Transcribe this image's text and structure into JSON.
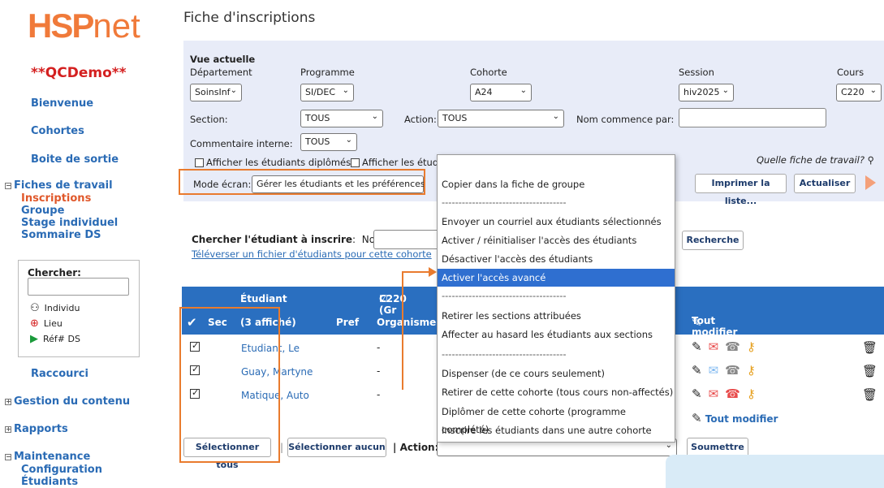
{
  "sidebar": {
    "logo_main": "HSP",
    "logo_suffix": "net",
    "demo": "**QCDemo**",
    "links": [
      "Bienvenue",
      "Cohortes",
      "Boite de sortie"
    ],
    "fiches_title": "Fiches de travail",
    "fiches_items": [
      "Inscriptions",
      "Groupe",
      "Stage individuel",
      "Sommaire DS"
    ],
    "search_label": "Chercher",
    "search_options": [
      "Individu",
      "Lieu",
      "Réf# DS"
    ],
    "raccourci": "Raccourci",
    "sections": [
      "Gestion du contenu",
      "Rapports",
      "Maintenance"
    ],
    "maint_items": [
      "Configuration",
      "Étudiants"
    ]
  },
  "page_title": "Fiche d'inscriptions",
  "filters": {
    "current_view": "Vue actuelle",
    "dept_label": "Département",
    "dept_value": "SoinsInf",
    "prog_label": "Programme",
    "prog_value": "SI/DEC",
    "cohort_label": "Cohorte",
    "cohort_value": "A24",
    "session_label": "Session",
    "session_value": "hiv2025",
    "course_label": "Cours",
    "course_value": "C220",
    "section_label": "Section:",
    "section_value": "TOUS",
    "action_label": "Action:",
    "action_value": "TOUS",
    "name_starts_label": "Nom commence par:",
    "comment_label": "Commentaire interne:",
    "comment_value": "TOUS",
    "cb1": "Afficher les étudiants diplômés",
    "cb2": "Afficher les étud",
    "which_sheet": "Quelle fiche de travail?",
    "mode_label": "Mode écran:",
    "mode_value": "Gérer les étudiants et les préférences",
    "print_btn": "Imprimer la liste...",
    "refresh_btn": "Actualiser"
  },
  "search_student": {
    "label": "Chercher l'étudiant à inscrire",
    "name_label": "Nom:",
    "upload_link": "Téléverser un fichier d'étudiants pour cette cohorte",
    "search_btn": "Recherche"
  },
  "dropdown": [
    "Copier dans la fiche de groupe",
    "-------------------------------------",
    "Envoyer un courriel aux étudiants sélectionnés",
    "Activer / réinitialiser l'accès des étudiants",
    "Désactiver l'accès des étudiants",
    "Activer l'accès avancé",
    "-------------------------------------",
    "Retirer les sections attribuées",
    "Affecter au hasard les étudiants aux sections",
    "-------------------------------------",
    "Dispenser (de ce cours seulement)",
    "Retirer de cette cohorte (tous cours non-affectés)",
    "Diplômer de cette cohorte (programme complété)",
    "Inscrire les étudiants dans une autre cohorte"
  ],
  "grid": {
    "h_student": "Étudiant",
    "h_course": "C220 (Gr",
    "h_sec": "Sec",
    "h_count": "(3 affiché)",
    "h_pref": "Pref",
    "h_org": "Organisme",
    "h_modify": "Tout modifier",
    "rows": [
      {
        "name": "Etudiant, Le",
        "dash": "-"
      },
      {
        "name": "Guay, Martyne",
        "dash": "-"
      },
      {
        "name": "Matique, Auto",
        "dash": "-"
      }
    ],
    "modify_link": "Tout modifier"
  },
  "footer": {
    "select_all": "Sélectionner tous",
    "select_none": "Sélectionner aucun",
    "action_label": "Action:",
    "submit": "Soumettre"
  }
}
